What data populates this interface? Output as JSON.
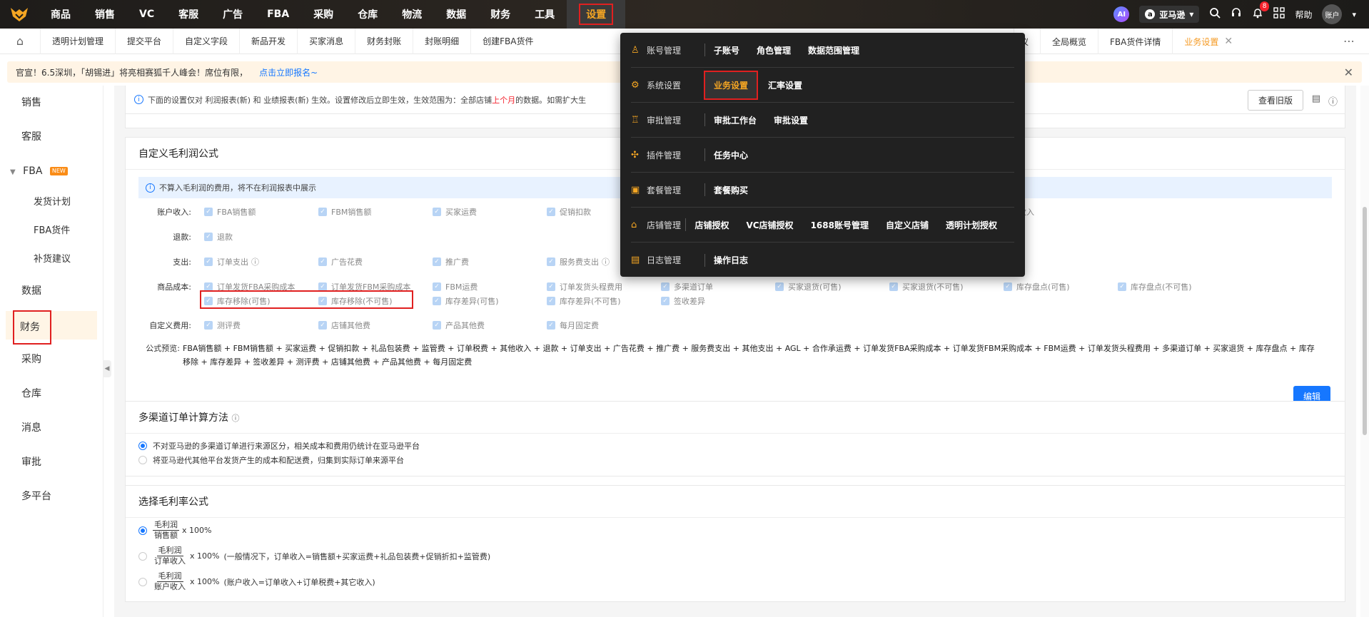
{
  "topnav": {
    "items": [
      "商品",
      "销售",
      "VC",
      "客服",
      "广告",
      "FBA",
      "采购",
      "仓库",
      "物流",
      "数据",
      "财务",
      "工具",
      "设置"
    ],
    "active_index": 12,
    "ai_label": "AI",
    "marketplace": "亚马逊",
    "help": "帮助",
    "account": "账户",
    "bell_count": "8"
  },
  "tabs": {
    "items": [
      "透明计划管理",
      "提交平台",
      "自定义字段",
      "新品开发",
      "买家消息",
      "财务封账",
      "封账明细",
      "创建FBA货件"
    ],
    "right_items": [
      "仪",
      "全局概览",
      "FBA货件详情"
    ],
    "active": "业务设置"
  },
  "notice": {
    "text": "官宣！6.5深圳，「胡锡进」将亮相赛狐千人峰会！席位有限，",
    "link": "点击立即报名~"
  },
  "sidebar": {
    "items": [
      "销售",
      "客服"
    ],
    "fba_group": "FBA",
    "new_badge": "NEW",
    "fba_sub": [
      "发货计划",
      "FBA货件",
      "补货建议"
    ],
    "items_after": [
      "数据",
      "财务",
      "采购",
      "仓库",
      "消息",
      "审批",
      "多平台"
    ]
  },
  "info": {
    "p1": "下面的设置仅对 利润报表(新) 和 业绩报表(新) 生效。设置修改后立即生效，生效范围为：全部店铺",
    "p2": "上个月",
    "p3": "的数据。如需扩大生",
    "old_version": "查看旧版"
  },
  "gross": {
    "title": "自定义毛利润公式",
    "tip": "不算入毛利润的费用，将不在利润报表中展示",
    "labels": {
      "income": "账户收入:",
      "refund": "退款:",
      "expense": "支出:",
      "cost": "商品成本:",
      "custom": "自定义费用:",
      "formula": "公式预览:"
    },
    "income": [
      "FBA销售额",
      "FBM销售额",
      "买家运费",
      "促销扣款",
      "他收入"
    ],
    "refund": [
      "退款"
    ],
    "expense": [
      "订单支出",
      "广告花费",
      "推广费",
      "服务费支出"
    ],
    "cost_row1": [
      "订单发货FBA采购成本",
      "订单发货FBM采购成本",
      "FBM运费",
      "订单发货头程费用",
      "多渠道订单",
      "买家退货(可售)",
      "买家退货(不可售)",
      "库存盘点(可售)",
      "库存盘点(不可售)"
    ],
    "cost_row2": [
      "库存移除(可售)",
      "库存移除(不可售)",
      "库存差异(可售)",
      "库存差异(不可售)",
      "签收差异"
    ],
    "custom": [
      "测评费",
      "店铺其他费",
      "产品其他费",
      "每月固定费"
    ],
    "formula_text": "FBA销售额 + FBM销售额 + 买家运费 + 促销扣款 + 礼品包装费 + 监管费 + 订单税费 + 其他收入 + 退款 + 订单支出 + 广告花费 + 推广费 + 服务费支出 + 其他支出 + AGL + 合作承运费 + 订单发货FBA采购成本 + 订单发货FBM采购成本 + FBM运费 + 订单发货头程费用 + 多渠道订单 + 买家退货 + 库存盘点 + 库存移除 + 库存差异 + 签收差异 + 测评费 + 店铺其他费 + 产品其他费 + 每月固定费",
    "edit": "编辑"
  },
  "multichannel": {
    "title": "多渠道订单计算方法",
    "opt1": "不对亚马逊的多渠道订单进行来源区分，相关成本和费用仍统计在亚马逊平台",
    "opt2": "将亚马逊代其他平台发货产生的成本和配送费，归集到实际订单来源平台"
  },
  "margin": {
    "title": "选择毛利率公式",
    "num": "毛利润",
    "den1": "销售额",
    "den2": "订单收入",
    "den3": "账户收入",
    "times": "x 100%",
    "note2": "(一般情况下，订单收入=销售额+买家运费+礼品包装费+促销折扣+监管费)",
    "note3": "(账户收入=订单收入+订单税费+其它收入)"
  },
  "menu": {
    "rows": [
      {
        "cat": "账号管理",
        "icon": "user-icon",
        "items": [
          "子账号",
          "角色管理",
          "数据范围管理"
        ]
      },
      {
        "cat": "系统设置",
        "icon": "gear-icon",
        "items": [
          "业务设置",
          "汇率设置"
        ]
      },
      {
        "cat": "审批管理",
        "icon": "stamp-icon",
        "items": [
          "审批工作台",
          "审批设置"
        ]
      },
      {
        "cat": "插件管理",
        "icon": "puzzle-icon",
        "items": [
          "任务中心"
        ]
      },
      {
        "cat": "套餐管理",
        "icon": "package-icon",
        "items": [
          "套餐购买"
        ]
      },
      {
        "cat": "店铺管理",
        "icon": "shop-icon",
        "items": [
          "店铺授权",
          "VC店铺授权",
          "1688账号管理",
          "自定义店铺",
          "透明计划授权"
        ]
      },
      {
        "cat": "日志管理",
        "icon": "log-icon",
        "items": [
          "操作日志"
        ]
      }
    ]
  }
}
